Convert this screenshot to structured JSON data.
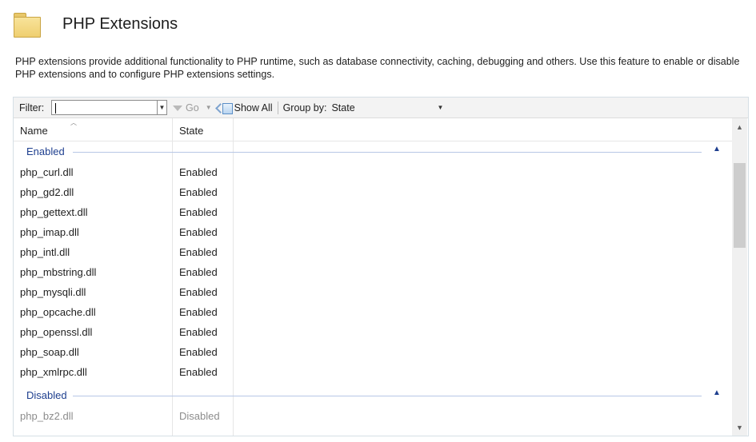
{
  "header": {
    "title": "PHP Extensions",
    "icon": "folder-icon"
  },
  "description": "PHP extensions provide additional functionality to PHP runtime, such as database connectivity, caching, debugging and others. Use this feature to enable or disable PHP extensions and to configure PHP extensions settings.",
  "toolbar": {
    "filter_label": "Filter:",
    "filter_value": "",
    "go_label": "Go",
    "show_all_label": "Show All",
    "group_by_label": "Group by:",
    "group_by_value": "State"
  },
  "columns": {
    "name": "Name",
    "state": "State"
  },
  "groups": [
    {
      "label": "Enabled",
      "rows": [
        {
          "name": "php_curl.dll",
          "state": "Enabled"
        },
        {
          "name": "php_gd2.dll",
          "state": "Enabled"
        },
        {
          "name": "php_gettext.dll",
          "state": "Enabled"
        },
        {
          "name": "php_imap.dll",
          "state": "Enabled"
        },
        {
          "name": "php_intl.dll",
          "state": "Enabled"
        },
        {
          "name": "php_mbstring.dll",
          "state": "Enabled"
        },
        {
          "name": "php_mysqli.dll",
          "state": "Enabled"
        },
        {
          "name": "php_opcache.dll",
          "state": "Enabled"
        },
        {
          "name": "php_openssl.dll",
          "state": "Enabled"
        },
        {
          "name": "php_soap.dll",
          "state": "Enabled"
        },
        {
          "name": "php_xmlrpc.dll",
          "state": "Enabled"
        }
      ]
    },
    {
      "label": "Disabled",
      "rows": [
        {
          "name": "php_bz2.dll",
          "state": "Disabled"
        }
      ]
    }
  ],
  "colors": {
    "group_text": "#1e3f8f",
    "group_line": "#b7c7e6",
    "disabled_text": "#8c8c8c"
  }
}
